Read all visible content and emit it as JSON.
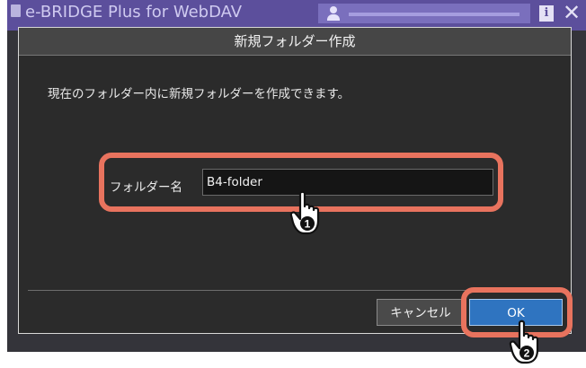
{
  "window": {
    "title": "e-BRIDGE Plus for WebDAV",
    "info_glyph": "i",
    "close_glyph": "✕"
  },
  "dialog": {
    "title": "新規フォルダー作成",
    "message": "現在のフォルダー内に新規フォルダーを作成できます。",
    "folder_name_label": "フォルダー名",
    "folder_name_value": "B4-folder",
    "cancel_label": "キャンセル",
    "ok_label": "OK"
  },
  "annotations": {
    "step1": "1",
    "step2": "2"
  },
  "colors": {
    "titlebar": "#5c4f9c",
    "highlight": "#e8735e",
    "ok_button": "#2f74c0",
    "dialog_bg": "#2b2b2b"
  },
  "icons": [
    "app-icon",
    "user-icon",
    "info-icon",
    "close-icon",
    "hand-pointer-icon"
  ]
}
